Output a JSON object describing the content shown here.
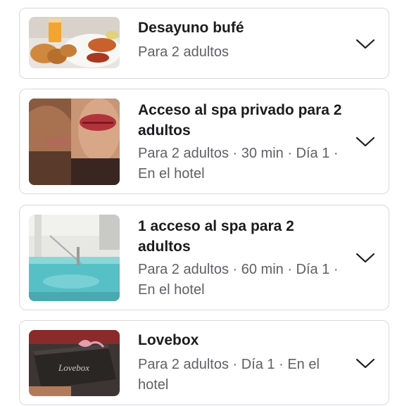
{
  "items": [
    {
      "title": "Desayuno bufé",
      "meta": "Para 2 adultos",
      "image_icon": "breakfast-photo"
    },
    {
      "title": "Acceso al spa privado para 2 adultos",
      "meta": "Para 2 adultos · 30 min · Día 1 · En el hotel",
      "image_icon": "couple-photo"
    },
    {
      "title": "1 acceso al spa para 2 adultos",
      "meta": "Para 2 adultos · 60 min · Día 1 · En el hotel",
      "image_icon": "spa-pool-photo"
    },
    {
      "title": "Lovebox",
      "meta": "Para 2 adultos · Día 1 · En el hotel",
      "image_icon": "lovebox-photo",
      "image_text": "Lovebox"
    }
  ],
  "colors": {
    "border": "#d9d9de",
    "title": "#1c1c1e",
    "meta": "#5f5f66",
    "chevron": "#1c1c1e"
  }
}
